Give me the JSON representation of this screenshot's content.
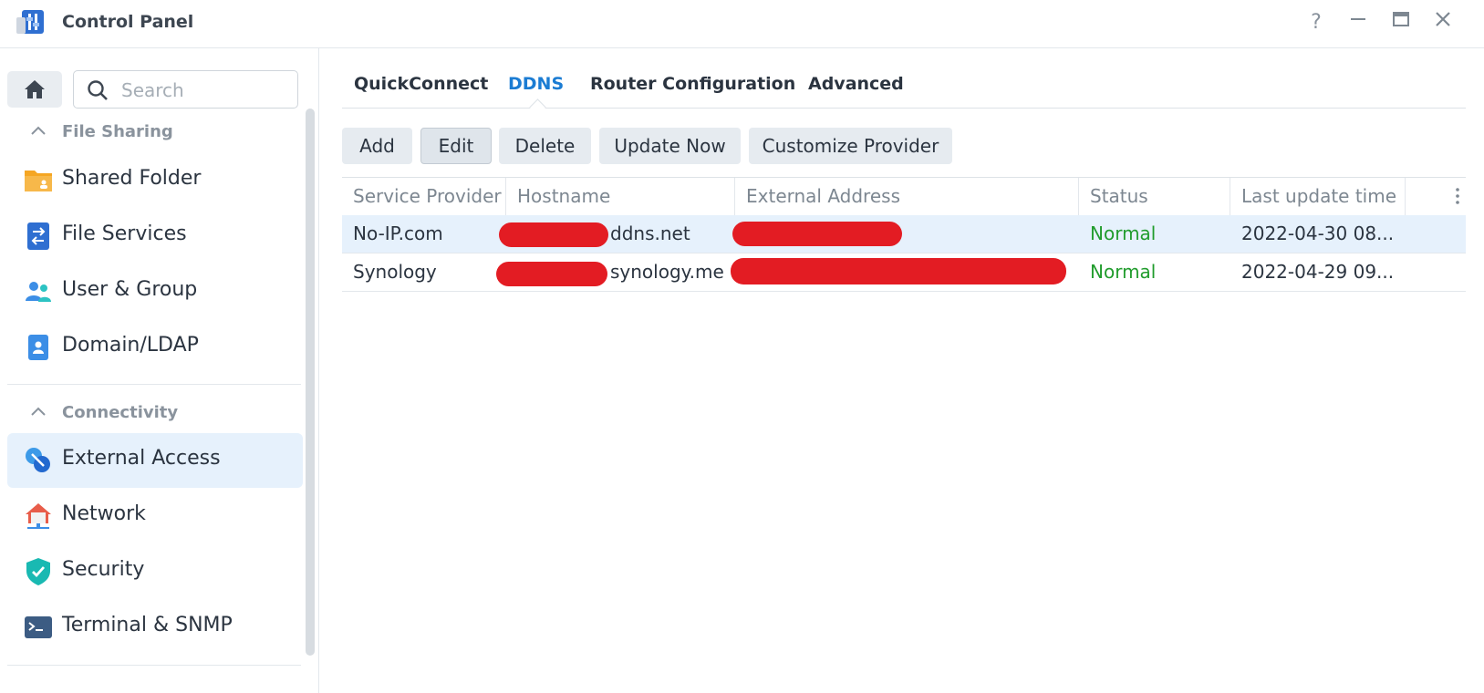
{
  "window": {
    "title": "Control Panel",
    "controls": {
      "help": "?",
      "minimize": "—",
      "maximize": "□",
      "close": "✕"
    }
  },
  "sidebar": {
    "search_placeholder": "Search",
    "sections": [
      {
        "label": "File Sharing",
        "items": [
          "Shared Folder",
          "File Services",
          "User & Group",
          "Domain/LDAP"
        ]
      },
      {
        "label": "Connectivity",
        "items": [
          "External Access",
          "Network",
          "Security",
          "Terminal & SNMP"
        ]
      }
    ],
    "active_item": "External Access"
  },
  "tabs": [
    "QuickConnect",
    "DDNS",
    "Router Configuration",
    "Advanced"
  ],
  "active_tab": "DDNS",
  "toolbar": [
    "Add",
    "Edit",
    "Delete",
    "Update Now",
    "Customize Provider"
  ],
  "table": {
    "columns": [
      "Service Provider",
      "Hostname",
      "External Address",
      "Status",
      "Last update time"
    ],
    "rows": [
      {
        "provider": "No-IP.com",
        "hostname_suffix": "ddns.net",
        "status": "Normal",
        "last_update": "2022-04-30 08..."
      },
      {
        "provider": "Synology",
        "hostname_suffix": "synology.me",
        "status": "Normal",
        "last_update": "2022-04-29 09..."
      }
    ]
  },
  "colors": {
    "accent": "#1b7cd3",
    "status_normal": "#219c2d",
    "redaction": "#e31c23",
    "selected_row": "#e6f1fc"
  }
}
